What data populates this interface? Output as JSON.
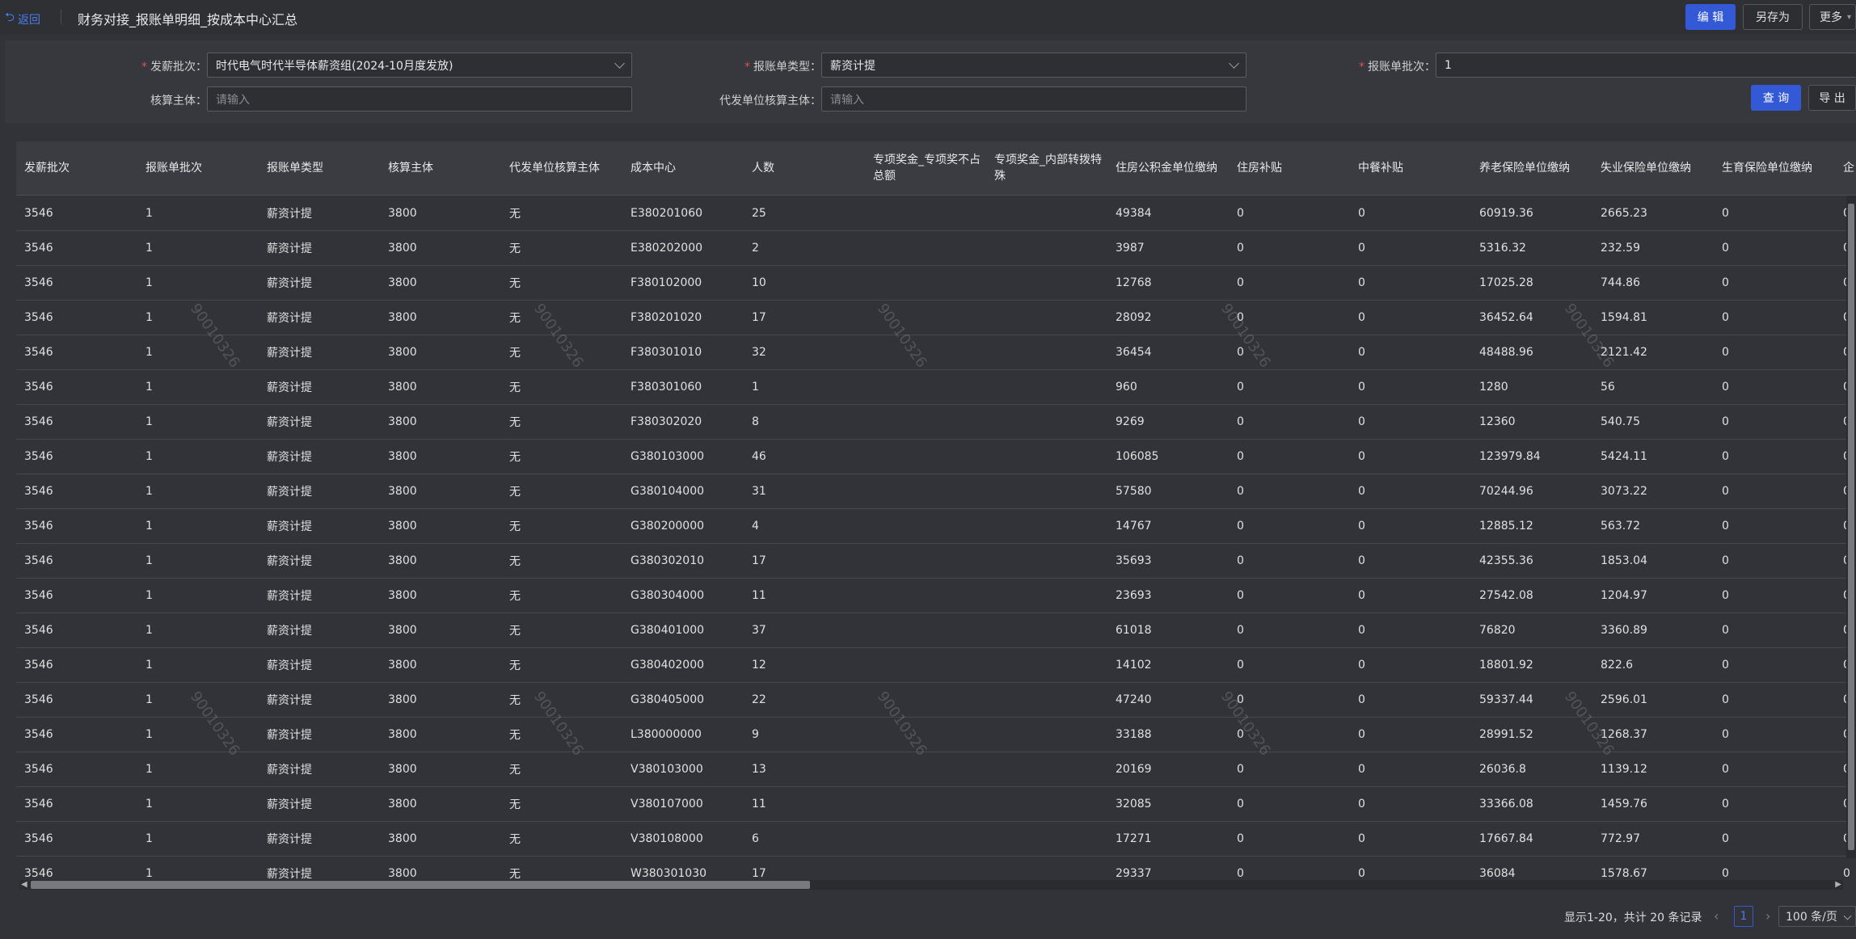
{
  "header": {
    "back_label": "返回",
    "title": "财务对接_报账单明细_按成本中心汇总",
    "edit_label": "编 辑",
    "save_as_label": "另存为",
    "more_label": "更多"
  },
  "filters": {
    "batch_label": "发薪批次：",
    "batch_value": "时代电气时代半导体薪资组(2024-10月度发放)",
    "type_label": "报账单类型：",
    "type_value": "薪资计提",
    "bill_batch_label": "报账单批次：",
    "bill_batch_value": "1",
    "entity_label": "核算主体：",
    "entity_placeholder": "请输入",
    "agent_entity_label": "代发单位核算主体：",
    "agent_entity_placeholder": "请输入",
    "query_label": "查 询",
    "export_label": "导 出"
  },
  "table": {
    "headers": [
      "发薪批次",
      "报账单批次",
      "报账单类型",
      "核算主体",
      "代发单位核算主体",
      "成本中心",
      "人数",
      "专项奖金_专项奖不占总额",
      "专项奖金_内部转拨特殊",
      "住房公积金单位缴纳",
      "住房补贴",
      "中餐补贴",
      "养老保险单位缴纳",
      "失业保险单位缴纳",
      "生育保险单位缴纳",
      "企"
    ],
    "rows": [
      [
        "3546",
        "1",
        "薪资计提",
        "3800",
        "无",
        "E380201060",
        "25",
        "",
        "",
        "49384",
        "0",
        "0",
        "60919.36",
        "2665.23",
        "0",
        "0"
      ],
      [
        "3546",
        "1",
        "薪资计提",
        "3800",
        "无",
        "E380202000",
        "2",
        "",
        "",
        "3987",
        "0",
        "0",
        "5316.32",
        "232.59",
        "0",
        "0"
      ],
      [
        "3546",
        "1",
        "薪资计提",
        "3800",
        "无",
        "F380102000",
        "10",
        "",
        "",
        "12768",
        "0",
        "0",
        "17025.28",
        "744.86",
        "0",
        "0"
      ],
      [
        "3546",
        "1",
        "薪资计提",
        "3800",
        "无",
        "F380201020",
        "17",
        "",
        "",
        "28092",
        "0",
        "0",
        "36452.64",
        "1594.81",
        "0",
        "0"
      ],
      [
        "3546",
        "1",
        "薪资计提",
        "3800",
        "无",
        "F380301010",
        "32",
        "",
        "",
        "36454",
        "0",
        "0",
        "48488.96",
        "2121.42",
        "0",
        "0"
      ],
      [
        "3546",
        "1",
        "薪资计提",
        "3800",
        "无",
        "F380301060",
        "1",
        "",
        "",
        "960",
        "0",
        "0",
        "1280",
        "56",
        "0",
        "0"
      ],
      [
        "3546",
        "1",
        "薪资计提",
        "3800",
        "无",
        "F380302020",
        "8",
        "",
        "",
        "9269",
        "0",
        "0",
        "12360",
        "540.75",
        "0",
        "0"
      ],
      [
        "3546",
        "1",
        "薪资计提",
        "3800",
        "无",
        "G380103000",
        "46",
        "",
        "",
        "106085",
        "0",
        "0",
        "123979.84",
        "5424.11",
        "0",
        "0"
      ],
      [
        "3546",
        "1",
        "薪资计提",
        "3800",
        "无",
        "G380104000",
        "31",
        "",
        "",
        "57580",
        "0",
        "0",
        "70244.96",
        "3073.22",
        "0",
        "0"
      ],
      [
        "3546",
        "1",
        "薪资计提",
        "3800",
        "无",
        "G380200000",
        "4",
        "",
        "",
        "14767",
        "0",
        "0",
        "12885.12",
        "563.72",
        "0",
        "0"
      ],
      [
        "3546",
        "1",
        "薪资计提",
        "3800",
        "无",
        "G380302010",
        "17",
        "",
        "",
        "35693",
        "0",
        "0",
        "42355.36",
        "1853.04",
        "0",
        "0"
      ],
      [
        "3546",
        "1",
        "薪资计提",
        "3800",
        "无",
        "G380304000",
        "11",
        "",
        "",
        "23693",
        "0",
        "0",
        "27542.08",
        "1204.97",
        "0",
        "0"
      ],
      [
        "3546",
        "1",
        "薪资计提",
        "3800",
        "无",
        "G380401000",
        "37",
        "",
        "",
        "61018",
        "0",
        "0",
        "76820",
        "3360.89",
        "0",
        "0"
      ],
      [
        "3546",
        "1",
        "薪资计提",
        "3800",
        "无",
        "G380402000",
        "12",
        "",
        "",
        "14102",
        "0",
        "0",
        "18801.92",
        "822.6",
        "0",
        "0"
      ],
      [
        "3546",
        "1",
        "薪资计提",
        "3800",
        "无",
        "G380405000",
        "22",
        "",
        "",
        "47240",
        "0",
        "0",
        "59337.44",
        "2596.01",
        "0",
        "0"
      ],
      [
        "3546",
        "1",
        "薪资计提",
        "3800",
        "无",
        "L380000000",
        "9",
        "",
        "",
        "33188",
        "0",
        "0",
        "28991.52",
        "1268.37",
        "0",
        "0"
      ],
      [
        "3546",
        "1",
        "薪资计提",
        "3800",
        "无",
        "V380103000",
        "13",
        "",
        "",
        "20169",
        "0",
        "0",
        "26036.8",
        "1139.12",
        "0",
        "0"
      ],
      [
        "3546",
        "1",
        "薪资计提",
        "3800",
        "无",
        "V380107000",
        "11",
        "",
        "",
        "32085",
        "0",
        "0",
        "33366.08",
        "1459.76",
        "0",
        "0"
      ],
      [
        "3546",
        "1",
        "薪资计提",
        "3800",
        "无",
        "V380108000",
        "6",
        "",
        "",
        "17271",
        "0",
        "0",
        "17667.84",
        "772.97",
        "0",
        "0"
      ],
      [
        "3546",
        "1",
        "薪资计提",
        "3800",
        "无",
        "W380301030",
        "17",
        "",
        "",
        "29337",
        "0",
        "0",
        "36084",
        "1578.67",
        "0",
        "0"
      ]
    ]
  },
  "watermark_text": "90010326",
  "pagination": {
    "summary": "显示1-20，共计 20 条记录",
    "current_page": "1",
    "page_size": "100 条/页"
  }
}
